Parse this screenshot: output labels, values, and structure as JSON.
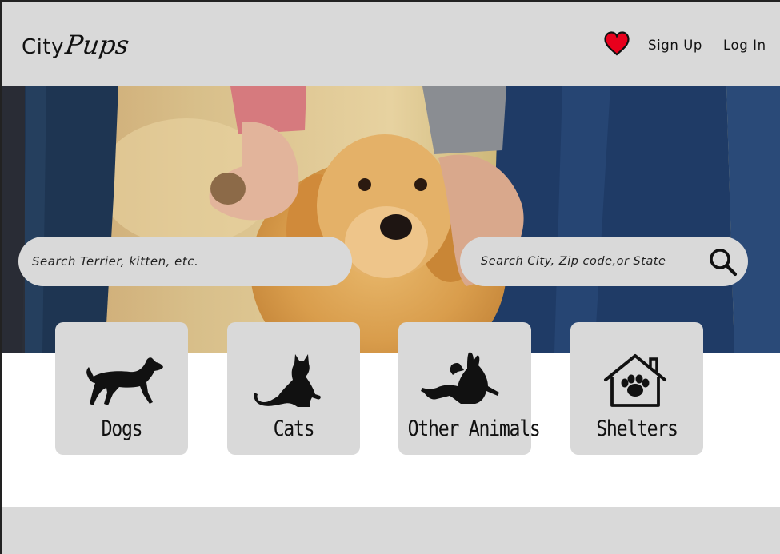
{
  "brand": {
    "city": "City",
    "pups": "Pups"
  },
  "nav": {
    "signup_label": "Sign Up",
    "login_label": "Log In",
    "favorites_icon": "heart-icon",
    "favorites_color": "#e8001c"
  },
  "search": {
    "pet_placeholder": "Search Terrier, kitten, etc.",
    "location_placeholder": "Search City, Zip code,or State"
  },
  "categories": [
    {
      "label": "Dogs",
      "icon": "dog-icon"
    },
    {
      "label": "Cats",
      "icon": "cat-icon"
    },
    {
      "label": "Other Animals",
      "icon": "other-animals-icon"
    },
    {
      "label": "Shelters",
      "icon": "shelter-icon"
    }
  ],
  "colors": {
    "panel": "#d9d9d9",
    "text": "#111111"
  }
}
